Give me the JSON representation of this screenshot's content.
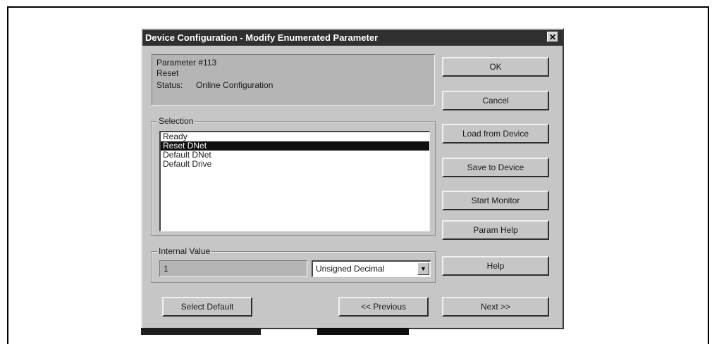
{
  "dialog": {
    "title": "Device Configuration - Modify Enumerated Parameter",
    "close_glyph": "✕"
  },
  "info": {
    "parameter": "Parameter #113",
    "name": "Reset",
    "status_label": "Status:",
    "status_value": "Online Configuration"
  },
  "selection": {
    "label": "Selection",
    "items": [
      "Ready",
      "Reset DNet",
      "Default DNet",
      "Default Drive"
    ],
    "selected_index": 1
  },
  "internal_value": {
    "label": "Internal Value",
    "value": "1",
    "format_selected": "Unsigned Decimal"
  },
  "buttons": {
    "ok": "OK",
    "cancel": "Cancel",
    "load_from_device": "Load from Device",
    "save_to_device": "Save to Device",
    "start_monitor": "Start Monitor",
    "param_help": "Param Help",
    "help": "Help",
    "select_default": "Select Default",
    "previous": "<< Previous",
    "next": "Next >>"
  },
  "icons": {
    "combo_arrow": "dropdown-arrow-icon"
  }
}
